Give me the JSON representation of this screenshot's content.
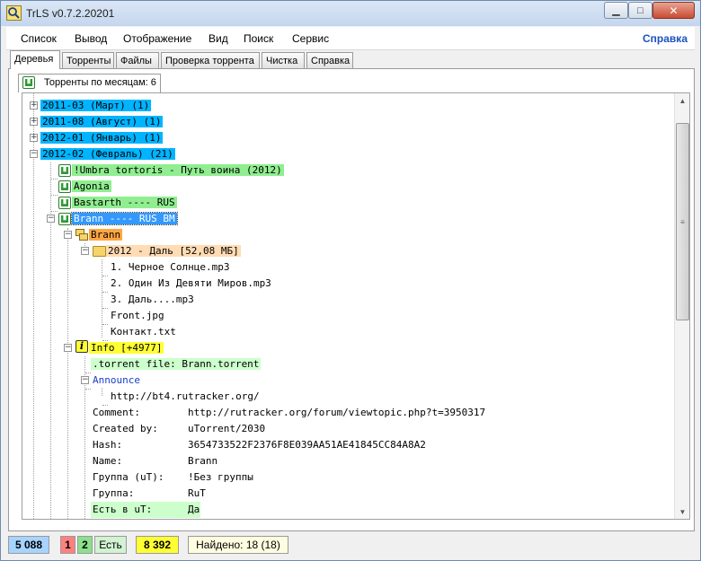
{
  "window": {
    "title": "TrLS v0.7.2.20201",
    "close_glyph": "✕"
  },
  "menu": {
    "items": [
      "Список",
      "Вывод",
      "Отображение",
      "Вид",
      "Поиск",
      "Сервис"
    ],
    "help": "Справка"
  },
  "tabs": [
    "Деревья",
    "Торренты",
    "Файлы",
    "Проверка торрента",
    "Чистка",
    "Справка"
  ],
  "subtab": {
    "label": "Торренты по месяцам: 6"
  },
  "tree": {
    "months": [
      "2011-03 (Март) (1)",
      "2011-08 (Август) (1)",
      "2012-01 (Январь) (1)",
      "2012-02 (Февраль) (21)"
    ],
    "torrents": [
      "!Umbra tortoris - Путь воина (2012)",
      "Agonia",
      "Bastarth ---- RUS",
      "Brann ---- RUS BM"
    ],
    "root_folder": "Brann",
    "album_folder": "2012 - Даль [52,08 МБ]",
    "files": [
      "1. Черное Солнце.mp3",
      "2. Один Из Девяти Миров.mp3",
      "3. Даль....mp3",
      "Front.jpg",
      "Контакт.txt"
    ],
    "info": "Info [+4977]",
    "torrent_file": ".torrent file: Brann.torrent",
    "announce_label": "Announce",
    "announce_url": "http://bt4.rutracker.org/",
    "props": [
      {
        "key": "Comment:",
        "value": "http://rutracker.org/forum/viewtopic.php?t=3950317"
      },
      {
        "key": "Created by:",
        "value": "uTorrent/2030"
      },
      {
        "key": "Hash:",
        "value": "3654733522F2376F8E039AA51AE41845CC84A8A2"
      },
      {
        "key": "Name:",
        "value": "Brann"
      },
      {
        "key": "Группа (uT):",
        "value": "!Без группы"
      },
      {
        "key": "Группа:",
        "value": "RuT"
      },
      {
        "key": "Есть в uT:",
        "value": "Да"
      }
    ]
  },
  "status": {
    "total": "5 088",
    "red": "1",
    "green": "2",
    "exists": "Есть",
    "count": "8 392",
    "found": "Найдено: 18 (18)"
  },
  "colors": {
    "month_bg": "#00b4ff",
    "torrent_bg": "#90ee90",
    "selected_bg": "#3399ff",
    "folder_bg": "#ffa640",
    "info_bg": "#ffff33",
    "help_link": "#1a52c2"
  },
  "icons": [
    "app-search-icon",
    "utorrent-icon",
    "folder-icon",
    "multi-folder-icon",
    "info-icon",
    "expand-icon",
    "collapse-icon"
  ]
}
